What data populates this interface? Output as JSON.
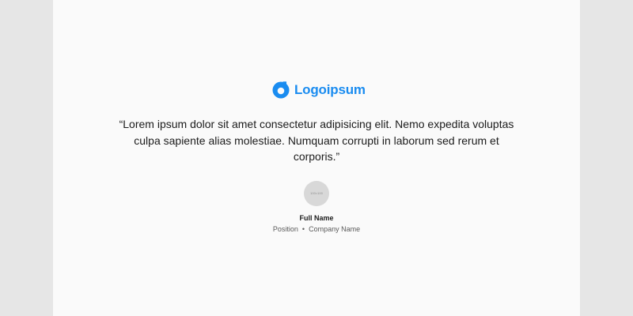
{
  "brand": {
    "name": "Logoipsum",
    "accent_color": "#1a8cf0",
    "icon": "logoipsum-mark-icon"
  },
  "testimonial": {
    "quote": "“Lorem ipsum dolor sit amet consectetur adipisicing elit. Nemo expedita voluptas culpa sapiente alias molestiae. Numquam corrupti in laborum sed rerum et corporis.”",
    "avatar_placeholder": "100×100",
    "author_name": "Full Name",
    "author_position": "Position",
    "separator": "•",
    "company_name": "Company Name"
  }
}
